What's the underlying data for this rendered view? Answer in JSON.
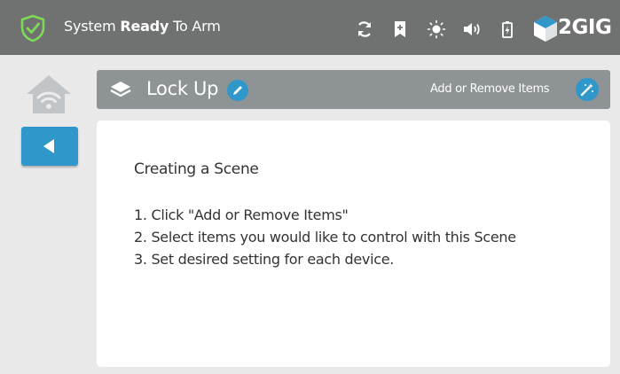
{
  "status": {
    "prefix": "System ",
    "strong": "Ready",
    "suffix": " To Arm"
  },
  "brand": {
    "name": "2GIG"
  },
  "toolbar": {
    "icons": [
      "refresh-icon",
      "bookmark-plus-icon",
      "brightness-icon",
      "volume-icon",
      "battery-icon"
    ]
  },
  "header": {
    "scene_name": "Lock Up",
    "add_remove_label": "Add or Remove Items"
  },
  "content": {
    "heading": "Creating a Scene",
    "steps": [
      "1. Click \"Add or Remove Items\"",
      "2. Select items you would like to control with this Scene",
      "3. Set desired setting for each device."
    ]
  },
  "colors": {
    "topbar": "#707272",
    "accent": "#2f97c9",
    "shield": "#7ed957",
    "header": "#8e9396",
    "background": "#e9e9e9"
  }
}
